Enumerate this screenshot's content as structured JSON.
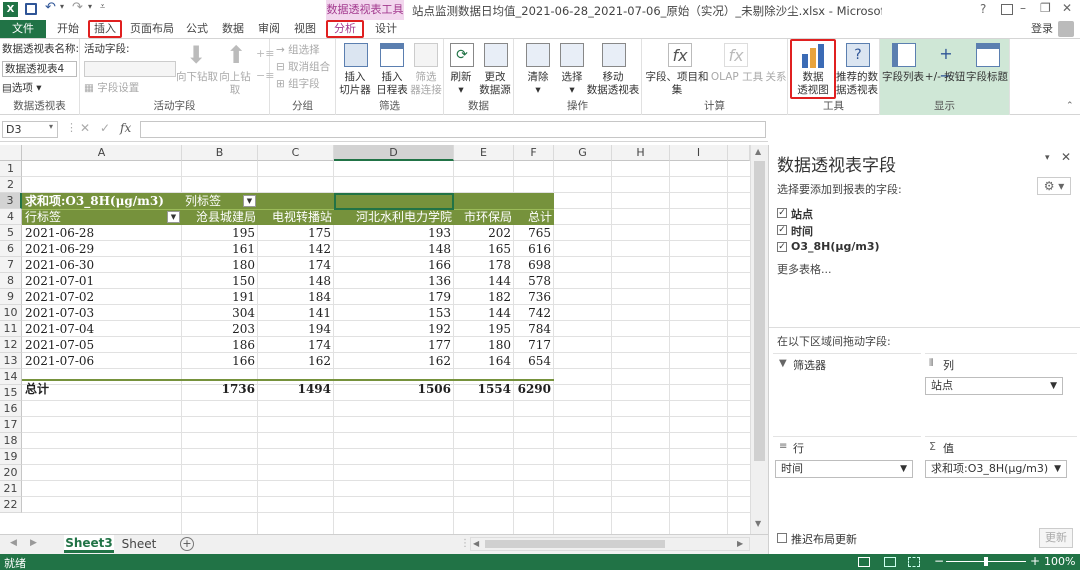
{
  "window": {
    "title": "站点监测数据日均值_2021-06-28_2021-07-06_原始（实况）_未剔除沙尘.xlsx - Microsoft Excel",
    "context_tool": "数据透视表工具",
    "controls": [
      "?",
      "–",
      "❐",
      "✕"
    ],
    "login": "登录"
  },
  "tabs": [
    "文件",
    "开始",
    "插入",
    "页面布局",
    "公式",
    "数据",
    "审阅",
    "视图",
    "分析",
    "设计"
  ],
  "ribbon": {
    "pt_group": {
      "name_label": "数据透视表名称:",
      "name_value": "数据透视表4",
      "options": "选项",
      "label": "数据透视表"
    },
    "active_field": {
      "label_field": "活动字段:",
      "field_settings": "字段设置",
      "drill_down": "向下钻取",
      "drill_up": "向上钻取",
      "label": "活动字段"
    },
    "group": {
      "select": "→ 组选择",
      "ungroup": "取消组合",
      "field": "组字段",
      "label": "分组"
    },
    "filter": {
      "slicer": "插入\n切片器",
      "timeline": "插入\n日程表",
      "conn": "筛选\n器连接",
      "label": "筛选"
    },
    "data": {
      "refresh": "刷新",
      "change": "更改\n数据源",
      "label": "数据"
    },
    "actions": {
      "clear": "清除",
      "select": "选择",
      "move": "移动\n数据透视表",
      "label": "操作"
    },
    "calc": {
      "fields": "字段、项目和\n集",
      "olap": "OLAP 工具",
      "relations": "关系",
      "label": "计算"
    },
    "tools": {
      "pivotchart": "数据\n透视图",
      "recommended": "推荐的数\n据透视表",
      "label": "工具"
    },
    "show": {
      "fieldlist": "字段列表",
      "buttons": "+/- 按钮",
      "headers": "字段标题",
      "label": "显示"
    }
  },
  "formula": {
    "namebox": "D3",
    "fx": "fx",
    "value": ""
  },
  "columns": [
    "A",
    "B",
    "C",
    "D",
    "E",
    "F",
    "G",
    "H",
    "I"
  ],
  "rows": [
    "1",
    "2",
    "3",
    "4",
    "5",
    "6",
    "7",
    "8",
    "9",
    "10",
    "11",
    "12",
    "13",
    "14",
    "15",
    "16",
    "17",
    "18",
    "19",
    "20",
    "21",
    "22"
  ],
  "pivot": {
    "value_label": "求和项:O3_8H(μg/m3)",
    "col_label": "列标签",
    "row_label": "行标签",
    "headers": [
      "沧县城建局",
      "电视转播站",
      "河北水利电力学院",
      "市环保局",
      "总计"
    ],
    "data": [
      [
        "2021-06-28",
        "195",
        "175",
        "193",
        "202",
        "765"
      ],
      [
        "2021-06-29",
        "161",
        "142",
        "148",
        "165",
        "616"
      ],
      [
        "2021-06-30",
        "180",
        "174",
        "166",
        "178",
        "698"
      ],
      [
        "2021-07-01",
        "150",
        "148",
        "136",
        "144",
        "578"
      ],
      [
        "2021-07-02",
        "191",
        "184",
        "179",
        "182",
        "736"
      ],
      [
        "2021-07-03",
        "304",
        "141",
        "153",
        "144",
        "742"
      ],
      [
        "2021-07-04",
        "203",
        "194",
        "192",
        "195",
        "784"
      ],
      [
        "2021-07-05",
        "186",
        "174",
        "177",
        "180",
        "717"
      ],
      [
        "2021-07-06",
        "166",
        "162",
        "162",
        "164",
        "654"
      ]
    ],
    "total": [
      "总计",
      "1736",
      "1494",
      "1506",
      "1554",
      "6290"
    ]
  },
  "sheets": [
    "Sheet3",
    "Sheet"
  ],
  "status": {
    "ready": "就绪",
    "zoom": "100%"
  },
  "pane": {
    "title": "数据透视表字段",
    "subtitle": "选择要添加到报表的字段:",
    "fields": [
      "站点",
      "时间",
      "O3_8H(μg/m3)"
    ],
    "more": "更多表格...",
    "drag_hint": "在以下区域间拖动字段:",
    "filters": "筛选器",
    "columns": "列",
    "columns_value": "站点",
    "rows": "行",
    "rows_value": "时间",
    "values": "值",
    "values_value": "求和项:O3_8H(μg/m3)",
    "defer": "推迟布局更新",
    "update": "更新"
  },
  "colors": {
    "excel_green": "#217346",
    "pivot_green": "#76923c",
    "highlight": "#e02020",
    "context_pink": "#f2d7ee"
  }
}
